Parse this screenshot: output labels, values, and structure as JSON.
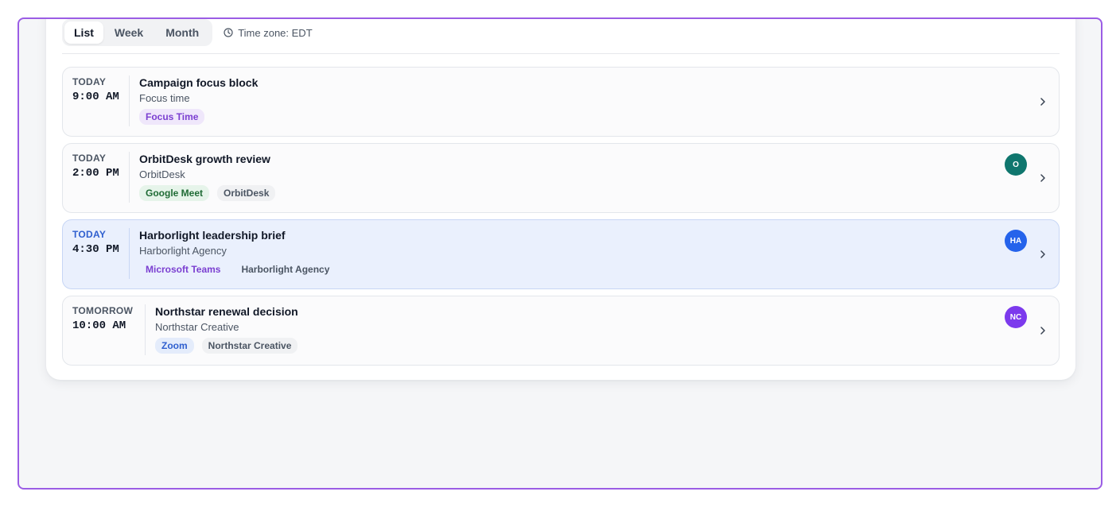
{
  "view_tabs": [
    {
      "label": "List",
      "active": true
    },
    {
      "label": "Week",
      "active": false
    },
    {
      "label": "Month",
      "active": false
    }
  ],
  "timezone": {
    "label": "Time zone: EDT",
    "icon": "clock-icon"
  },
  "events": [
    {
      "day": "TODAY",
      "time": "9:00 AM",
      "title": "Campaign focus block",
      "subtitle": "Focus time",
      "tags": [
        {
          "label": "Focus Time",
          "color": "#7b3fd1"
        }
      ],
      "avatar": null,
      "selected": false
    },
    {
      "day": "TODAY",
      "time": "2:00 PM",
      "title": "OrbitDesk growth review",
      "subtitle": "OrbitDesk",
      "tags": [
        {
          "label": "Google Meet",
          "color": "#1f6b35"
        },
        {
          "label": "OrbitDesk",
          "color": "#4b5563"
        }
      ],
      "avatar": {
        "initials": "O",
        "color": "#0f766e"
      },
      "selected": false
    },
    {
      "day": "TODAY",
      "time": "4:30 PM",
      "title": "Harborlight leadership brief",
      "subtitle": "Harborlight Agency",
      "tags": [
        {
          "label": "Microsoft Teams",
          "color": "#7b3fd1"
        },
        {
          "label": "Harborlight Agency",
          "color": "#4b5563"
        }
      ],
      "avatar": {
        "initials": "HA",
        "color": "#2563eb"
      },
      "selected": true
    },
    {
      "day": "TOMORROW",
      "time": "10:00 AM",
      "title": "Northstar renewal decision",
      "subtitle": "Northstar Creative",
      "tags": [
        {
          "label": "Zoom",
          "color": "#2f5fcf"
        },
        {
          "label": "Northstar Creative",
          "color": "#4b5563"
        }
      ],
      "avatar": {
        "initials": "NC",
        "color": "#7c3aed"
      },
      "selected": false
    }
  ]
}
